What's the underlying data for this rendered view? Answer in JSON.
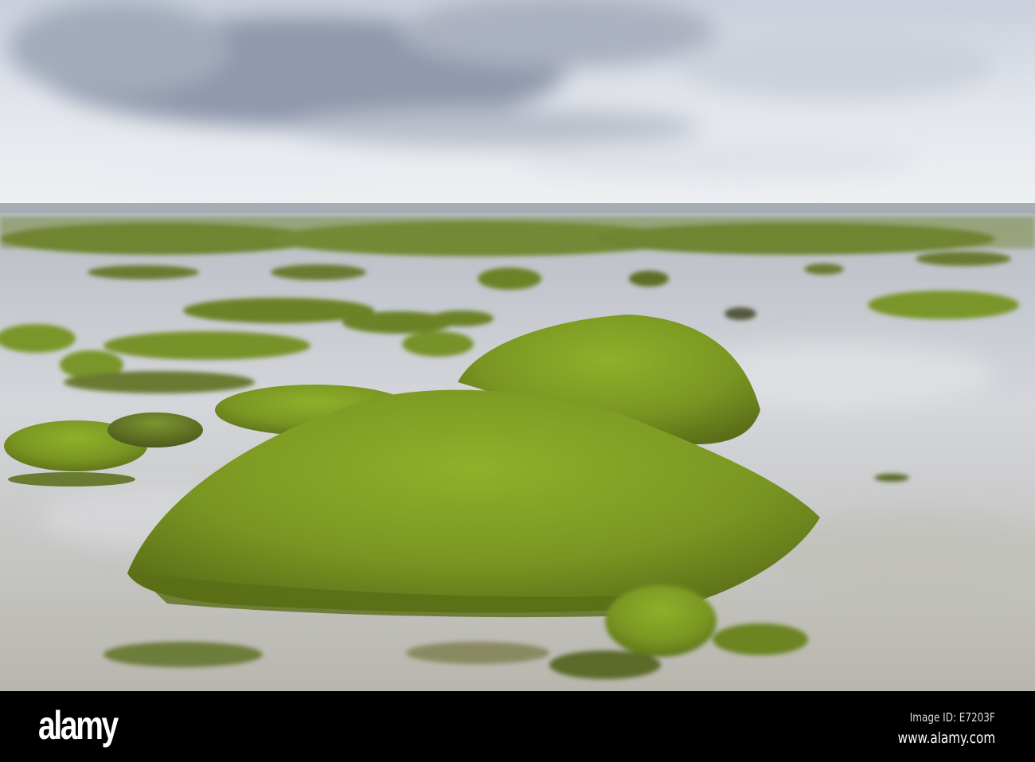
{
  "photo": {
    "subject": "Seaweed covered rocks in tidal pools at low tide",
    "colors": {
      "sky": "#dfe3ea",
      "cloud_dark": "#8e97ab",
      "water": "#c9ccd2",
      "algae": "#7d9a26",
      "algae_dark": "#4f6a12"
    }
  },
  "watermark": {
    "logo": "alamy",
    "image_id": "Image ID: E7203F",
    "website": "www.alamy.com"
  }
}
